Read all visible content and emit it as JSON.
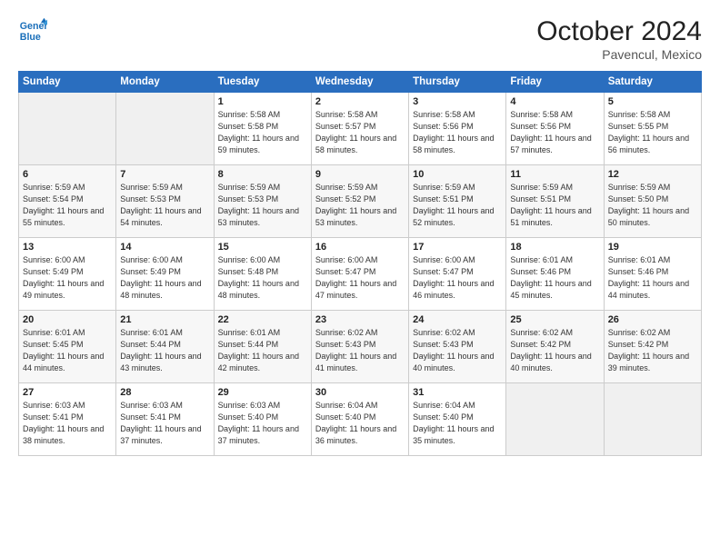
{
  "header": {
    "logo_line1": "General",
    "logo_line2": "Blue",
    "month": "October 2024",
    "location": "Pavencul, Mexico"
  },
  "weekdays": [
    "Sunday",
    "Monday",
    "Tuesday",
    "Wednesday",
    "Thursday",
    "Friday",
    "Saturday"
  ],
  "weeks": [
    [
      {
        "day": "",
        "detail": ""
      },
      {
        "day": "",
        "detail": ""
      },
      {
        "day": "1",
        "detail": "Sunrise: 5:58 AM\nSunset: 5:58 PM\nDaylight: 11 hours and 59 minutes."
      },
      {
        "day": "2",
        "detail": "Sunrise: 5:58 AM\nSunset: 5:57 PM\nDaylight: 11 hours and 58 minutes."
      },
      {
        "day": "3",
        "detail": "Sunrise: 5:58 AM\nSunset: 5:56 PM\nDaylight: 11 hours and 58 minutes."
      },
      {
        "day": "4",
        "detail": "Sunrise: 5:58 AM\nSunset: 5:56 PM\nDaylight: 11 hours and 57 minutes."
      },
      {
        "day": "5",
        "detail": "Sunrise: 5:58 AM\nSunset: 5:55 PM\nDaylight: 11 hours and 56 minutes."
      }
    ],
    [
      {
        "day": "6",
        "detail": "Sunrise: 5:59 AM\nSunset: 5:54 PM\nDaylight: 11 hours and 55 minutes."
      },
      {
        "day": "7",
        "detail": "Sunrise: 5:59 AM\nSunset: 5:53 PM\nDaylight: 11 hours and 54 minutes."
      },
      {
        "day": "8",
        "detail": "Sunrise: 5:59 AM\nSunset: 5:53 PM\nDaylight: 11 hours and 53 minutes."
      },
      {
        "day": "9",
        "detail": "Sunrise: 5:59 AM\nSunset: 5:52 PM\nDaylight: 11 hours and 53 minutes."
      },
      {
        "day": "10",
        "detail": "Sunrise: 5:59 AM\nSunset: 5:51 PM\nDaylight: 11 hours and 52 minutes."
      },
      {
        "day": "11",
        "detail": "Sunrise: 5:59 AM\nSunset: 5:51 PM\nDaylight: 11 hours and 51 minutes."
      },
      {
        "day": "12",
        "detail": "Sunrise: 5:59 AM\nSunset: 5:50 PM\nDaylight: 11 hours and 50 minutes."
      }
    ],
    [
      {
        "day": "13",
        "detail": "Sunrise: 6:00 AM\nSunset: 5:49 PM\nDaylight: 11 hours and 49 minutes."
      },
      {
        "day": "14",
        "detail": "Sunrise: 6:00 AM\nSunset: 5:49 PM\nDaylight: 11 hours and 48 minutes."
      },
      {
        "day": "15",
        "detail": "Sunrise: 6:00 AM\nSunset: 5:48 PM\nDaylight: 11 hours and 48 minutes."
      },
      {
        "day": "16",
        "detail": "Sunrise: 6:00 AM\nSunset: 5:47 PM\nDaylight: 11 hours and 47 minutes."
      },
      {
        "day": "17",
        "detail": "Sunrise: 6:00 AM\nSunset: 5:47 PM\nDaylight: 11 hours and 46 minutes."
      },
      {
        "day": "18",
        "detail": "Sunrise: 6:01 AM\nSunset: 5:46 PM\nDaylight: 11 hours and 45 minutes."
      },
      {
        "day": "19",
        "detail": "Sunrise: 6:01 AM\nSunset: 5:46 PM\nDaylight: 11 hours and 44 minutes."
      }
    ],
    [
      {
        "day": "20",
        "detail": "Sunrise: 6:01 AM\nSunset: 5:45 PM\nDaylight: 11 hours and 44 minutes."
      },
      {
        "day": "21",
        "detail": "Sunrise: 6:01 AM\nSunset: 5:44 PM\nDaylight: 11 hours and 43 minutes."
      },
      {
        "day": "22",
        "detail": "Sunrise: 6:01 AM\nSunset: 5:44 PM\nDaylight: 11 hours and 42 minutes."
      },
      {
        "day": "23",
        "detail": "Sunrise: 6:02 AM\nSunset: 5:43 PM\nDaylight: 11 hours and 41 minutes."
      },
      {
        "day": "24",
        "detail": "Sunrise: 6:02 AM\nSunset: 5:43 PM\nDaylight: 11 hours and 40 minutes."
      },
      {
        "day": "25",
        "detail": "Sunrise: 6:02 AM\nSunset: 5:42 PM\nDaylight: 11 hours and 40 minutes."
      },
      {
        "day": "26",
        "detail": "Sunrise: 6:02 AM\nSunset: 5:42 PM\nDaylight: 11 hours and 39 minutes."
      }
    ],
    [
      {
        "day": "27",
        "detail": "Sunrise: 6:03 AM\nSunset: 5:41 PM\nDaylight: 11 hours and 38 minutes."
      },
      {
        "day": "28",
        "detail": "Sunrise: 6:03 AM\nSunset: 5:41 PM\nDaylight: 11 hours and 37 minutes."
      },
      {
        "day": "29",
        "detail": "Sunrise: 6:03 AM\nSunset: 5:40 PM\nDaylight: 11 hours and 37 minutes."
      },
      {
        "day": "30",
        "detail": "Sunrise: 6:04 AM\nSunset: 5:40 PM\nDaylight: 11 hours and 36 minutes."
      },
      {
        "day": "31",
        "detail": "Sunrise: 6:04 AM\nSunset: 5:40 PM\nDaylight: 11 hours and 35 minutes."
      },
      {
        "day": "",
        "detail": ""
      },
      {
        "day": "",
        "detail": ""
      }
    ]
  ]
}
